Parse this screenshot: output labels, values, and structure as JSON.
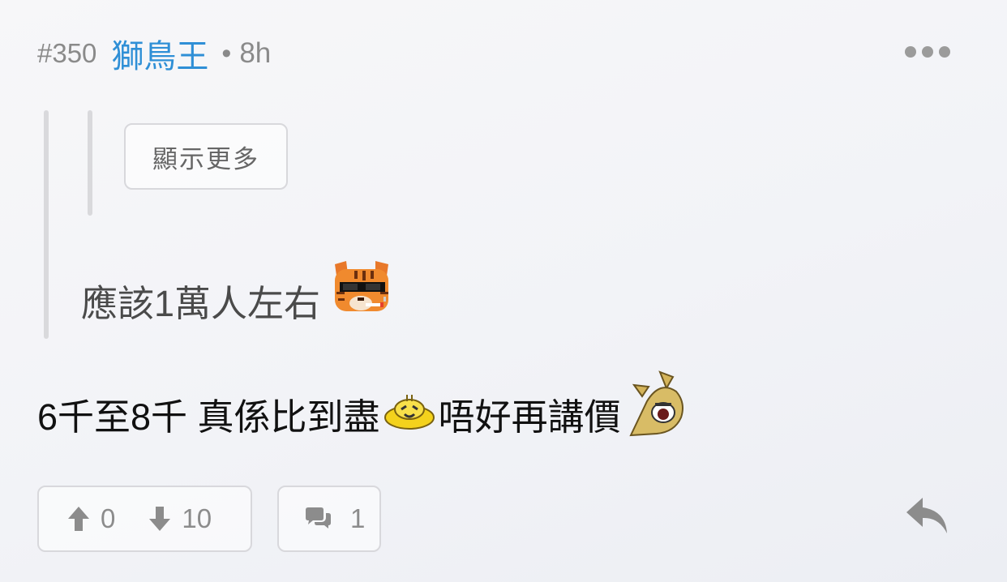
{
  "header": {
    "post_number": "#350",
    "author": "獅鳥王",
    "separator": "•",
    "time_ago": "8h",
    "more_icon": "ellipsis-horizontal-icon"
  },
  "quote": {
    "show_more_label": "顯示更多",
    "text": "應該1萬人左右",
    "emoji": "tiger-sunglasses-sticker"
  },
  "body": {
    "text_part1": "6千至8千 真係比到盡",
    "emoji1": "yellow-duck-sticker",
    "text_part2": "唔好再講價",
    "emoji2": "fox-shocked-sticker"
  },
  "actions": {
    "upvote_count": "0",
    "downvote_count": "10",
    "comment_count": "1",
    "upvote_icon": "arrow-up-icon",
    "downvote_icon": "arrow-down-icon",
    "comment_icon": "chat-bubbles-icon",
    "reply_icon": "reply-arrow-icon"
  },
  "colors": {
    "author": "#2f8fd6",
    "muted": "#8a8a8a",
    "border": "#d8d8dc",
    "text": "#111111"
  }
}
